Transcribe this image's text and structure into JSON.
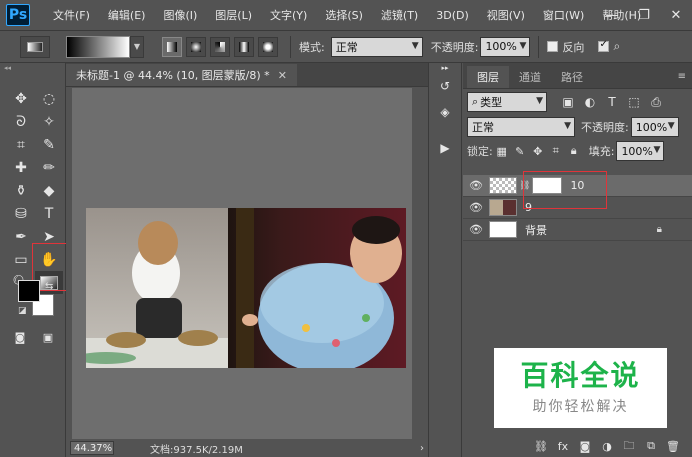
{
  "menubar": {
    "logo": "Ps",
    "items": [
      "文件(F)",
      "编辑(E)",
      "图像(I)",
      "图层(L)",
      "文字(Y)",
      "选择(S)",
      "滤镜(T)",
      "3D(D)",
      "视图(V)",
      "窗口(W)",
      "帮助(H)"
    ],
    "window_controls": [
      "minimize-icon",
      "restore-icon",
      "close-icon"
    ]
  },
  "options": {
    "mode_label": "模式:",
    "mode_value": "正常",
    "opacity_label": "不透明度:",
    "opacity_value": "100%",
    "reverse_label": "反向",
    "reverse_checked": false,
    "dither_checked": true
  },
  "document": {
    "tab_title": "未标题-1 @ 44.4% (10, 图层蒙版/8) *",
    "zoom": "44.37%",
    "doc_info": "文档:937.5K/2.19M"
  },
  "layers_panel": {
    "tabs": [
      "图层",
      "通道",
      "路径"
    ],
    "active_tab": "图层",
    "filter_value": "类型",
    "blend_mode": "正常",
    "opacity_label": "不透明度:",
    "opacity_value": "100%",
    "lock_label": "锁定:",
    "fill_label": "填充:",
    "fill_value": "100%",
    "layers": [
      {
        "name": "10",
        "selected": true,
        "has_mask": true
      },
      {
        "name": "9",
        "selected": false,
        "has_mask": false
      },
      {
        "name": "背景",
        "selected": false,
        "locked": true
      }
    ]
  },
  "watermark": {
    "title": "百科全说",
    "subtitle": "助你轻松解决"
  },
  "colors": {
    "highlight": "#e0343a",
    "watermark_green": "#1db34a",
    "ps_blue": "#31a8ff"
  }
}
